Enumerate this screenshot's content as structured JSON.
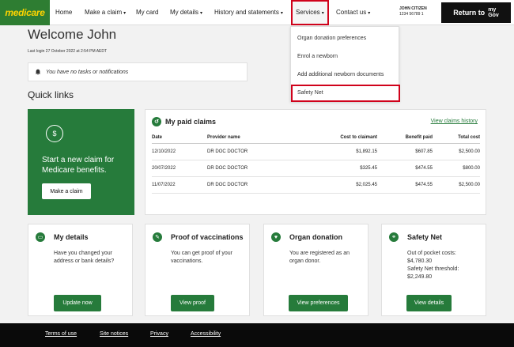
{
  "nav": {
    "logo": "medicare",
    "items": [
      {
        "label": "Home",
        "caret": ""
      },
      {
        "label": "Make a claim",
        "caret": "▾"
      },
      {
        "label": "My card",
        "caret": ""
      },
      {
        "label": "My details",
        "caret": "▾"
      },
      {
        "label": "History and statements",
        "caret": "▾"
      },
      {
        "label": "Services",
        "caret": "▾"
      },
      {
        "label": "Contact us",
        "caret": "▾"
      }
    ],
    "user_name": "JOHN CITIZEN",
    "user_number": "1234 56789 1",
    "return_label": "Return to",
    "mygov_top": "my",
    "mygov_bottom": "Gov"
  },
  "welcome": "Welcome John",
  "last_login": "Last login 27 October 2022 at 2:54 PM AEDT",
  "notice": "You have no tasks or notifications",
  "quick_links_title": "Quick links",
  "claim_card": {
    "title": "Start a new claim for Medicare benefits.",
    "button": "Make a claim"
  },
  "claims": {
    "title": "My paid claims",
    "view_all": "View claims history",
    "columns": [
      "Date",
      "Provider name",
      "Cost to claimant",
      "Benefit paid",
      "Total cost"
    ],
    "rows": [
      [
        "12/10/2022",
        "DR DOC DOCTOR",
        "$1,892.15",
        "$607.85",
        "$2,500.00"
      ],
      [
        "20/07/2022",
        "DR DOC DOCTOR",
        "$325.45",
        "$474.55",
        "$800.00"
      ],
      [
        "11/07/2022",
        "DR DOC DOCTOR",
        "$2,025.45",
        "$474.55",
        "$2,500.00"
      ]
    ]
  },
  "services_menu": [
    "Organ donation preferences",
    "Enrol a newborn",
    "Add additional newborn documents",
    "Safety Net"
  ],
  "cards": [
    {
      "title": "My details",
      "body": "Have you changed your address or bank details?",
      "button": "Update now",
      "icon": "id-card-icon"
    },
    {
      "title": "Proof of vaccinations",
      "body": "You can get proof of your vaccinations.",
      "button": "View proof",
      "icon": "syringe-icon"
    },
    {
      "title": "Organ donation",
      "body": "You are registered as an organ donor.",
      "button": "View preferences",
      "icon": "heart-icon"
    },
    {
      "title": "Safety Net",
      "body": "Out of pocket costs:\n$4,780.30\nSafety Net threshold:\n$2,249.80",
      "button": "View details",
      "icon": "network-icon"
    }
  ],
  "footer": [
    "Terms of use",
    "Site notices",
    "Privacy",
    "Accessibility"
  ],
  "colors": {
    "brand_green": "#267b3b",
    "highlight_red": "#d0021b",
    "logo_yellow": "#ffd400"
  }
}
